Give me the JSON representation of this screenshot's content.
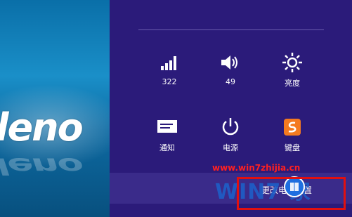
{
  "desktop": {
    "logo_text": "leno"
  },
  "charms": {
    "tiles": [
      {
        "icon": "signal-icon",
        "label": "322"
      },
      {
        "icon": "volume-icon",
        "label": "49"
      },
      {
        "icon": "brightness-icon",
        "label": "亮度"
      },
      {
        "icon": "notification-icon",
        "label": "通知"
      },
      {
        "icon": "power-icon",
        "label": "电源"
      },
      {
        "icon": "keyboard-icon",
        "label": "键盘"
      }
    ],
    "footer_label": "更改电脑设置"
  },
  "watermark": {
    "url": "www.win7zhijia.cn",
    "logo": "WIN7 家"
  }
}
